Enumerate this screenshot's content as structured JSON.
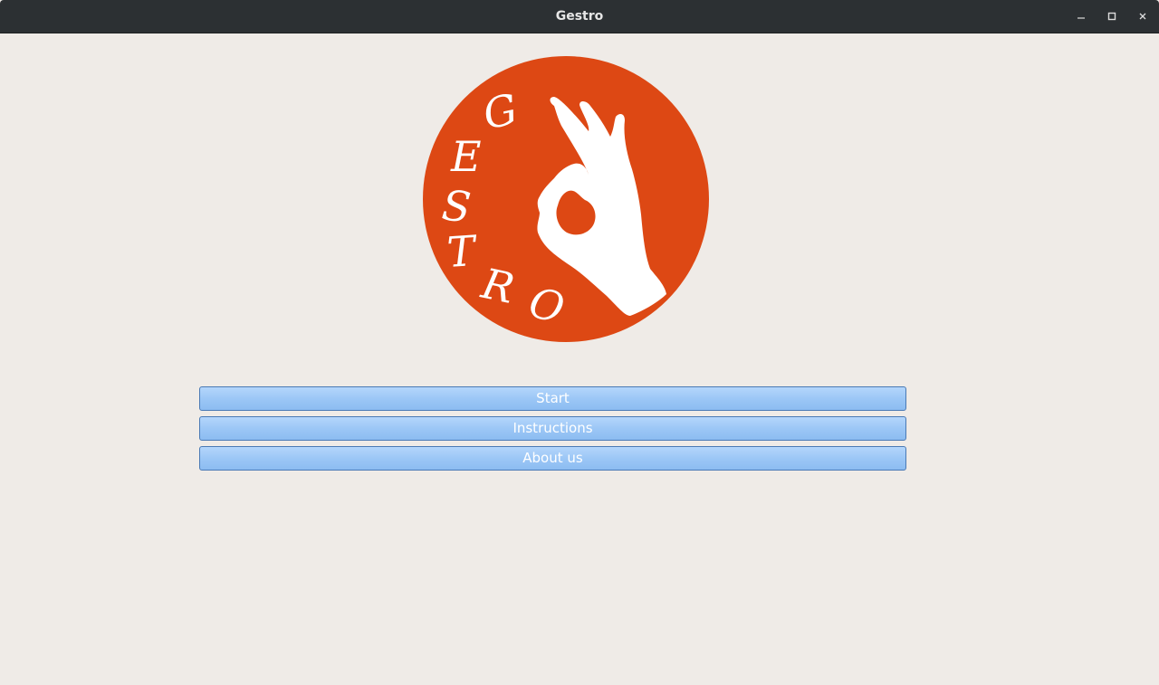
{
  "window": {
    "title": "Gestro"
  },
  "logo": {
    "text": "GESTRO",
    "letters": [
      "G",
      "E",
      "S",
      "T",
      "R",
      "O"
    ],
    "icon": "ok-hand-gesture-icon",
    "circle_color": "#dd4814",
    "foreground_color": "#ffffff"
  },
  "menu": {
    "start_label": "Start",
    "instructions_label": "Instructions",
    "about_label": "About us"
  },
  "colors": {
    "titlebar": "#2c3033",
    "background": "#efebe7",
    "button": "#9cc7f6",
    "button_border": "#4a7ab5"
  }
}
